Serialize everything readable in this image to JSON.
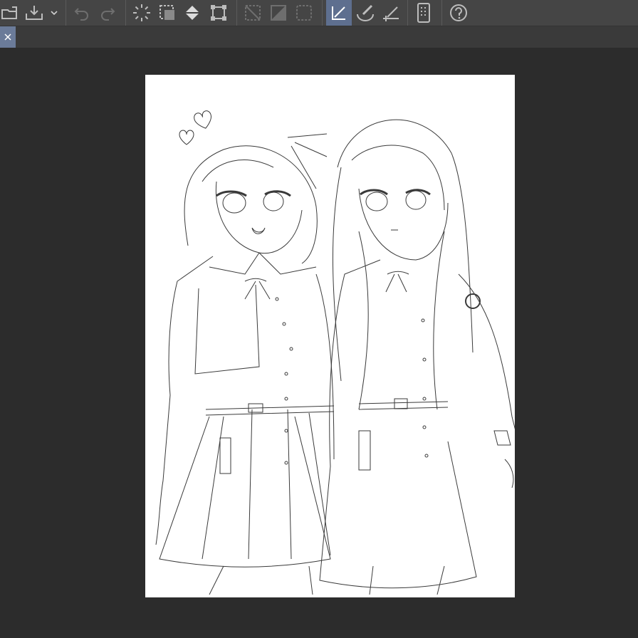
{
  "toolbar": {
    "items": [
      {
        "name": "open-file",
        "icon": "folder-open-icon"
      },
      {
        "name": "save",
        "icon": "save-tray-icon"
      },
      {
        "name": "save-dropdown",
        "icon": "chevron-down-icon"
      },
      {
        "name": "undo",
        "icon": "undo-icon"
      },
      {
        "name": "redo",
        "icon": "redo-icon"
      },
      {
        "name": "deselect",
        "icon": "spinner-deselect-icon"
      },
      {
        "name": "select-all",
        "icon": "marquee-icon"
      },
      {
        "name": "fill",
        "icon": "paint-bucket-icon"
      },
      {
        "name": "transform",
        "icon": "transform-icon"
      },
      {
        "name": "clear-outside",
        "icon": "clear-outside-icon"
      },
      {
        "name": "fill-selection",
        "icon": "fill-selection-icon"
      },
      {
        "name": "selection-border",
        "icon": "selection-border-icon"
      },
      {
        "name": "ruler-snap",
        "icon": "snap-ruler-icon",
        "active": true
      },
      {
        "name": "brush-snap",
        "icon": "brush-snap-icon"
      },
      {
        "name": "ruler-perspective",
        "icon": "ruler-icon"
      },
      {
        "name": "companion-mode",
        "icon": "phone-icon"
      },
      {
        "name": "help",
        "icon": "help-icon"
      }
    ],
    "accent": "#5e6f8f"
  },
  "tabbar": {
    "close_icon": "close-icon",
    "accent": "#6b7b99"
  },
  "canvas": {
    "background": "#ffffff",
    "content": "line-art-illustration"
  }
}
